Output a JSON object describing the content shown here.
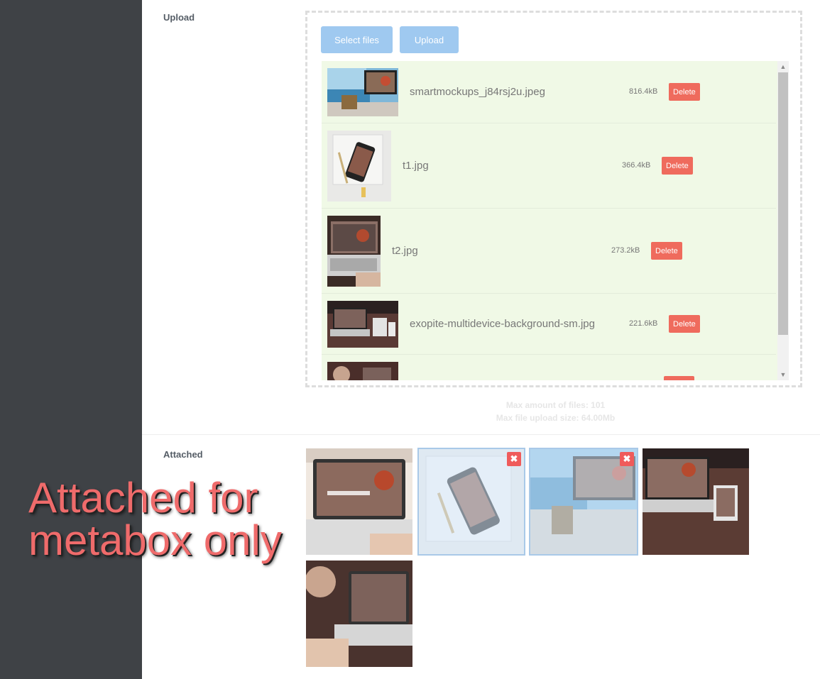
{
  "upload": {
    "label": "Upload",
    "select_files_label": "Select files",
    "upload_label": "Upload",
    "files": [
      {
        "name": "smartmockups_j84rsj2u.jpeg",
        "size": "816.4kB",
        "delete_label": "Delete"
      },
      {
        "name": "t1.jpg",
        "size": "366.4kB",
        "delete_label": "Delete"
      },
      {
        "name": "t2.jpg",
        "size": "273.2kB",
        "delete_label": "Delete"
      },
      {
        "name": "exopite-multidevice-background-sm.jpg",
        "size": "221.6kB",
        "delete_label": "Delete"
      }
    ],
    "max_files": "Max amount of files: 101",
    "max_size": "Max file upload size: 64.00Mb"
  },
  "attached": {
    "label": "Attached",
    "remove_icon": "close-icon",
    "remove_symbol": "✖"
  },
  "overlay": {
    "line1": "Attached for",
    "line2": "metabox only"
  },
  "colors": {
    "sidebar": "#3f4246",
    "button_blue": "#9fc9f0",
    "delete_red": "#ef6b5d",
    "list_bg": "#f0f9e6",
    "overlay_text": "#ef6b6b"
  }
}
